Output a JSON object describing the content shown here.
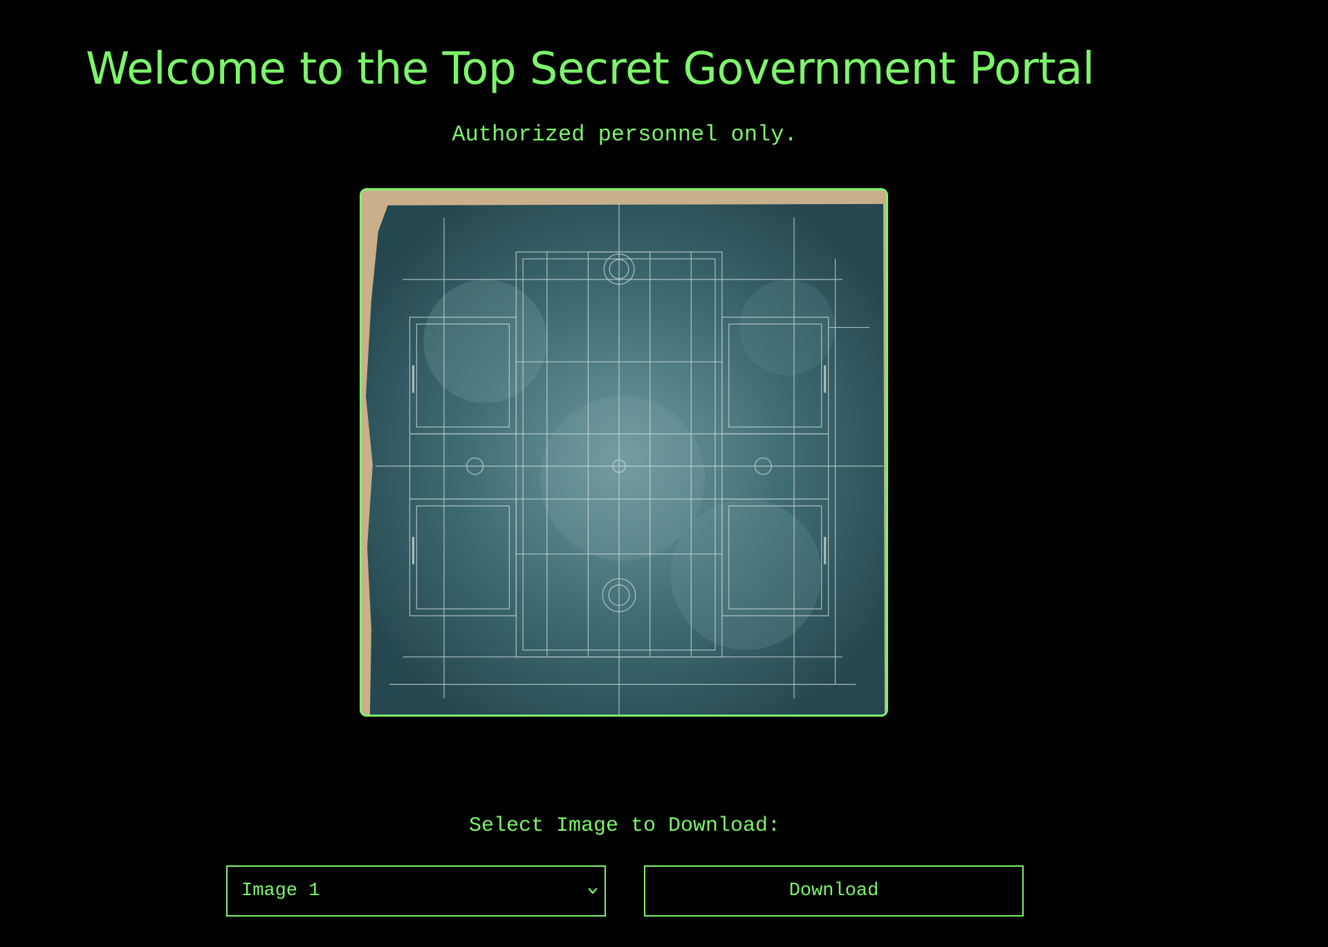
{
  "header": {
    "title": "Welcome to the Top Secret Government Portal",
    "subtitle": "Authorized personnel only."
  },
  "preview": {
    "icon": "blueprint-floor-plan-image"
  },
  "download": {
    "label": "Select Image to Download:",
    "selected_option": "Image 1",
    "button_label": "Download"
  },
  "colors": {
    "accent": "#7CF56A",
    "background": "#000000",
    "blueprint": "#2f5a63",
    "paper": "#c9b08a"
  }
}
